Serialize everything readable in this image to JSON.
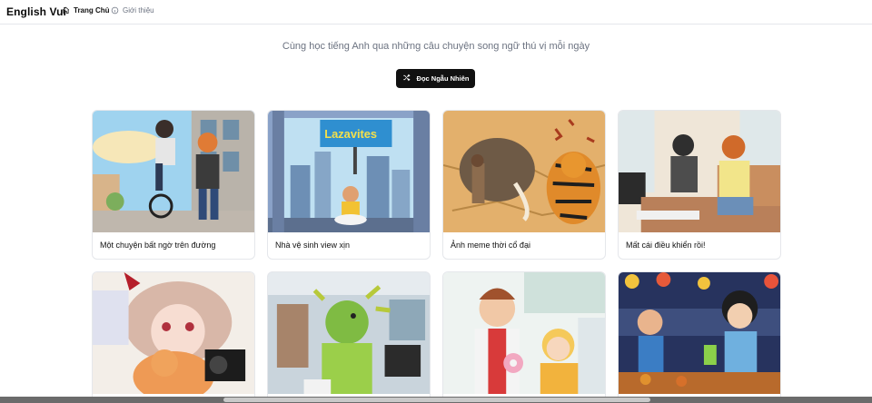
{
  "header": {
    "logo": "English Vui",
    "nav": [
      {
        "label": "Trang Chủ",
        "icon": "home-icon",
        "active": true
      },
      {
        "label": "Giới thiệu",
        "icon": "info-icon",
        "active": false
      }
    ]
  },
  "hero": {
    "tagline": "Cùng học tiếng Anh qua những câu chuyện song ngữ thú vị mỗi ngày",
    "random_button": {
      "label": "Đọc Ngẫu Nhiên",
      "icon": "shuffle-icon"
    }
  },
  "stories": [
    {
      "title": "Một chuyện bất ngờ trên đường",
      "image": "street-unicycle-illustration"
    },
    {
      "title": "Nhà vệ sinh view xịn",
      "image": "toilet-city-view-illustration",
      "sign_text": "Lazavites"
    },
    {
      "title": "Ảnh meme thời cổ đại",
      "image": "cave-painting-mammoth-tiger-illustration"
    },
    {
      "title": "Mất cái điều khiển rồi!",
      "image": "living-room-couple-illustration"
    },
    {
      "title": "",
      "image": "girl-with-cat-camera-illustration"
    },
    {
      "title": "",
      "image": "office-slime-man-illustration"
    },
    {
      "title": "",
      "image": "kitchen-donut-couple-illustration"
    },
    {
      "title": "",
      "image": "night-market-friends-illustration"
    }
  ],
  "colors": {
    "accent": "#111111",
    "muted": "#6b7280",
    "border": "#e5e7eb"
  }
}
